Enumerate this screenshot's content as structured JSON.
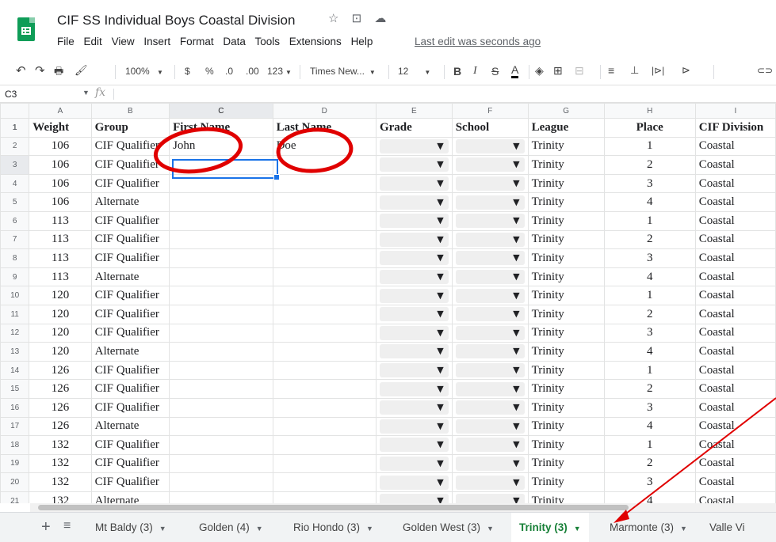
{
  "app": {
    "title": "CIF SS Individual Boys Coastal Division",
    "star_icon": "☆",
    "move_icon": "⊡",
    "cloud_icon": "☁",
    "last_edit": "Last edit was seconds ago"
  },
  "menu": [
    "File",
    "Edit",
    "View",
    "Insert",
    "Format",
    "Data",
    "Tools",
    "Extensions",
    "Help"
  ],
  "toolbar": {
    "undo": "↶",
    "redo": "↷",
    "print": "🖶",
    "paint_format": "🖌",
    "zoom": "100%",
    "currency": "$",
    "percent": "%",
    "decrease_decimal": ".0",
    "increase_decimal": ".00",
    "more_formats": "123",
    "font": "Times New...",
    "font_size": "12",
    "bold": "B",
    "italic": "I",
    "strike": "S",
    "text_color": "A",
    "fill": "◈",
    "borders": "⊞",
    "merge": "⊟",
    "halign": "≡",
    "valign": "⊥",
    "wrap": "|⊳|",
    "rotate": "⊳",
    "link": "⊂⊃"
  },
  "formula": {
    "cell_ref": "C3",
    "fx": "fx"
  },
  "grid": {
    "columns": [
      "A",
      "B",
      "C",
      "D",
      "E",
      "F",
      "G",
      "H",
      "I"
    ],
    "header_row": [
      "Weight",
      "Group",
      "First Name",
      "Last Name",
      "Grade",
      "School",
      "League",
      "Place",
      "CIF Division"
    ],
    "rows": [
      [
        "106",
        "CIF Qualifier",
        "John",
        "Doe",
        "",
        "",
        "Trinity",
        "1",
        "Coastal"
      ],
      [
        "106",
        "CIF Qualifier",
        "",
        "",
        "",
        "",
        "Trinity",
        "2",
        "Coastal"
      ],
      [
        "106",
        "CIF Qualifier",
        "",
        "",
        "",
        "",
        "Trinity",
        "3",
        "Coastal"
      ],
      [
        "106",
        "Alternate",
        "",
        "",
        "",
        "",
        "Trinity",
        "4",
        "Coastal"
      ],
      [
        "113",
        "CIF Qualifier",
        "",
        "",
        "",
        "",
        "Trinity",
        "1",
        "Coastal"
      ],
      [
        "113",
        "CIF Qualifier",
        "",
        "",
        "",
        "",
        "Trinity",
        "2",
        "Coastal"
      ],
      [
        "113",
        "CIF Qualifier",
        "",
        "",
        "",
        "",
        "Trinity",
        "3",
        "Coastal"
      ],
      [
        "113",
        "Alternate",
        "",
        "",
        "",
        "",
        "Trinity",
        "4",
        "Coastal"
      ],
      [
        "120",
        "CIF Qualifier",
        "",
        "",
        "",
        "",
        "Trinity",
        "1",
        "Coastal"
      ],
      [
        "120",
        "CIF Qualifier",
        "",
        "",
        "",
        "",
        "Trinity",
        "2",
        "Coastal"
      ],
      [
        "120",
        "CIF Qualifier",
        "",
        "",
        "",
        "",
        "Trinity",
        "3",
        "Coastal"
      ],
      [
        "120",
        "Alternate",
        "",
        "",
        "",
        "",
        "Trinity",
        "4",
        "Coastal"
      ],
      [
        "126",
        "CIF Qualifier",
        "",
        "",
        "",
        "",
        "Trinity",
        "1",
        "Coastal"
      ],
      [
        "126",
        "CIF Qualifier",
        "",
        "",
        "",
        "",
        "Trinity",
        "2",
        "Coastal"
      ],
      [
        "126",
        "CIF Qualifier",
        "",
        "",
        "",
        "",
        "Trinity",
        "3",
        "Coastal"
      ],
      [
        "126",
        "Alternate",
        "",
        "",
        "",
        "",
        "Trinity",
        "4",
        "Coastal"
      ],
      [
        "132",
        "CIF Qualifier",
        "",
        "",
        "",
        "",
        "Trinity",
        "1",
        "Coastal"
      ],
      [
        "132",
        "CIF Qualifier",
        "",
        "",
        "",
        "",
        "Trinity",
        "2",
        "Coastal"
      ],
      [
        "132",
        "CIF Qualifier",
        "",
        "",
        "",
        "",
        "Trinity",
        "3",
        "Coastal"
      ],
      [
        "132",
        "Alternate",
        "",
        "",
        "",
        "",
        "Trinity",
        "4",
        "Coastal"
      ]
    ]
  },
  "sheet_tabs": [
    {
      "label": "Mt Baldy (3)",
      "active": false
    },
    {
      "label": "Golden (4)",
      "active": false
    },
    {
      "label": "Rio Hondo (3)",
      "active": false
    },
    {
      "label": "Golden West (3)",
      "active": false
    },
    {
      "label": "Trinity (3)",
      "active": true
    },
    {
      "label": "Marmonte (3)",
      "active": false
    },
    {
      "label": "Valle Vi",
      "active": false
    }
  ],
  "tabbar_icons": {
    "add": "+",
    "all_sheets": "≡",
    "caret": "▼"
  },
  "colors": {
    "annotation": "#e00000",
    "active_tab": "#188038",
    "selection": "#1a73e8"
  }
}
